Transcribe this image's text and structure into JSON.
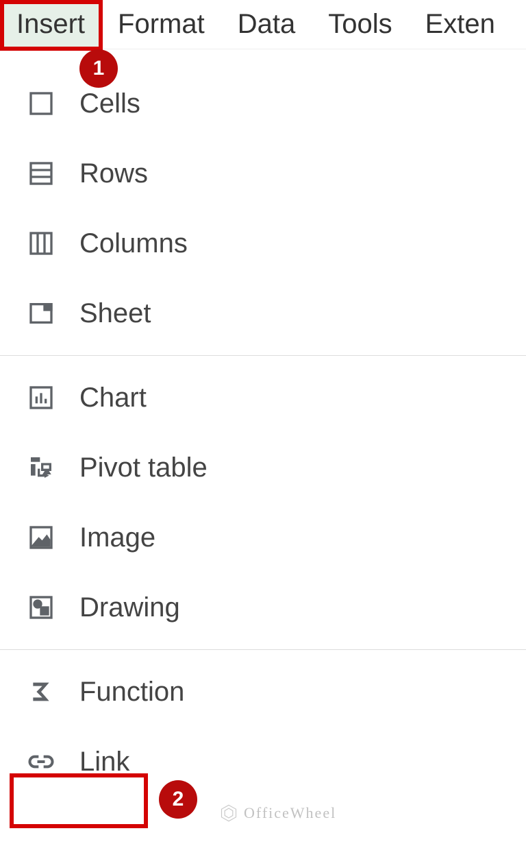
{
  "menubar": {
    "items": [
      "Insert",
      "Format",
      "Data",
      "Tools",
      "Exten"
    ],
    "active_index": 0
  },
  "menu": {
    "group1": [
      {
        "label": "Cells",
        "icon": "cells-icon"
      },
      {
        "label": "Rows",
        "icon": "rows-icon"
      },
      {
        "label": "Columns",
        "icon": "columns-icon"
      },
      {
        "label": "Sheet",
        "icon": "sheet-icon"
      }
    ],
    "group2": [
      {
        "label": "Chart",
        "icon": "chart-icon"
      },
      {
        "label": "Pivot table",
        "icon": "pivot-icon"
      },
      {
        "label": "Image",
        "icon": "image-icon"
      },
      {
        "label": "Drawing",
        "icon": "drawing-icon"
      }
    ],
    "group3": [
      {
        "label": "Function",
        "icon": "function-icon"
      },
      {
        "label": "Link",
        "icon": "link-icon"
      }
    ]
  },
  "annotations": {
    "badge1": "1",
    "badge2": "2"
  },
  "watermark": "OfficeWheel"
}
